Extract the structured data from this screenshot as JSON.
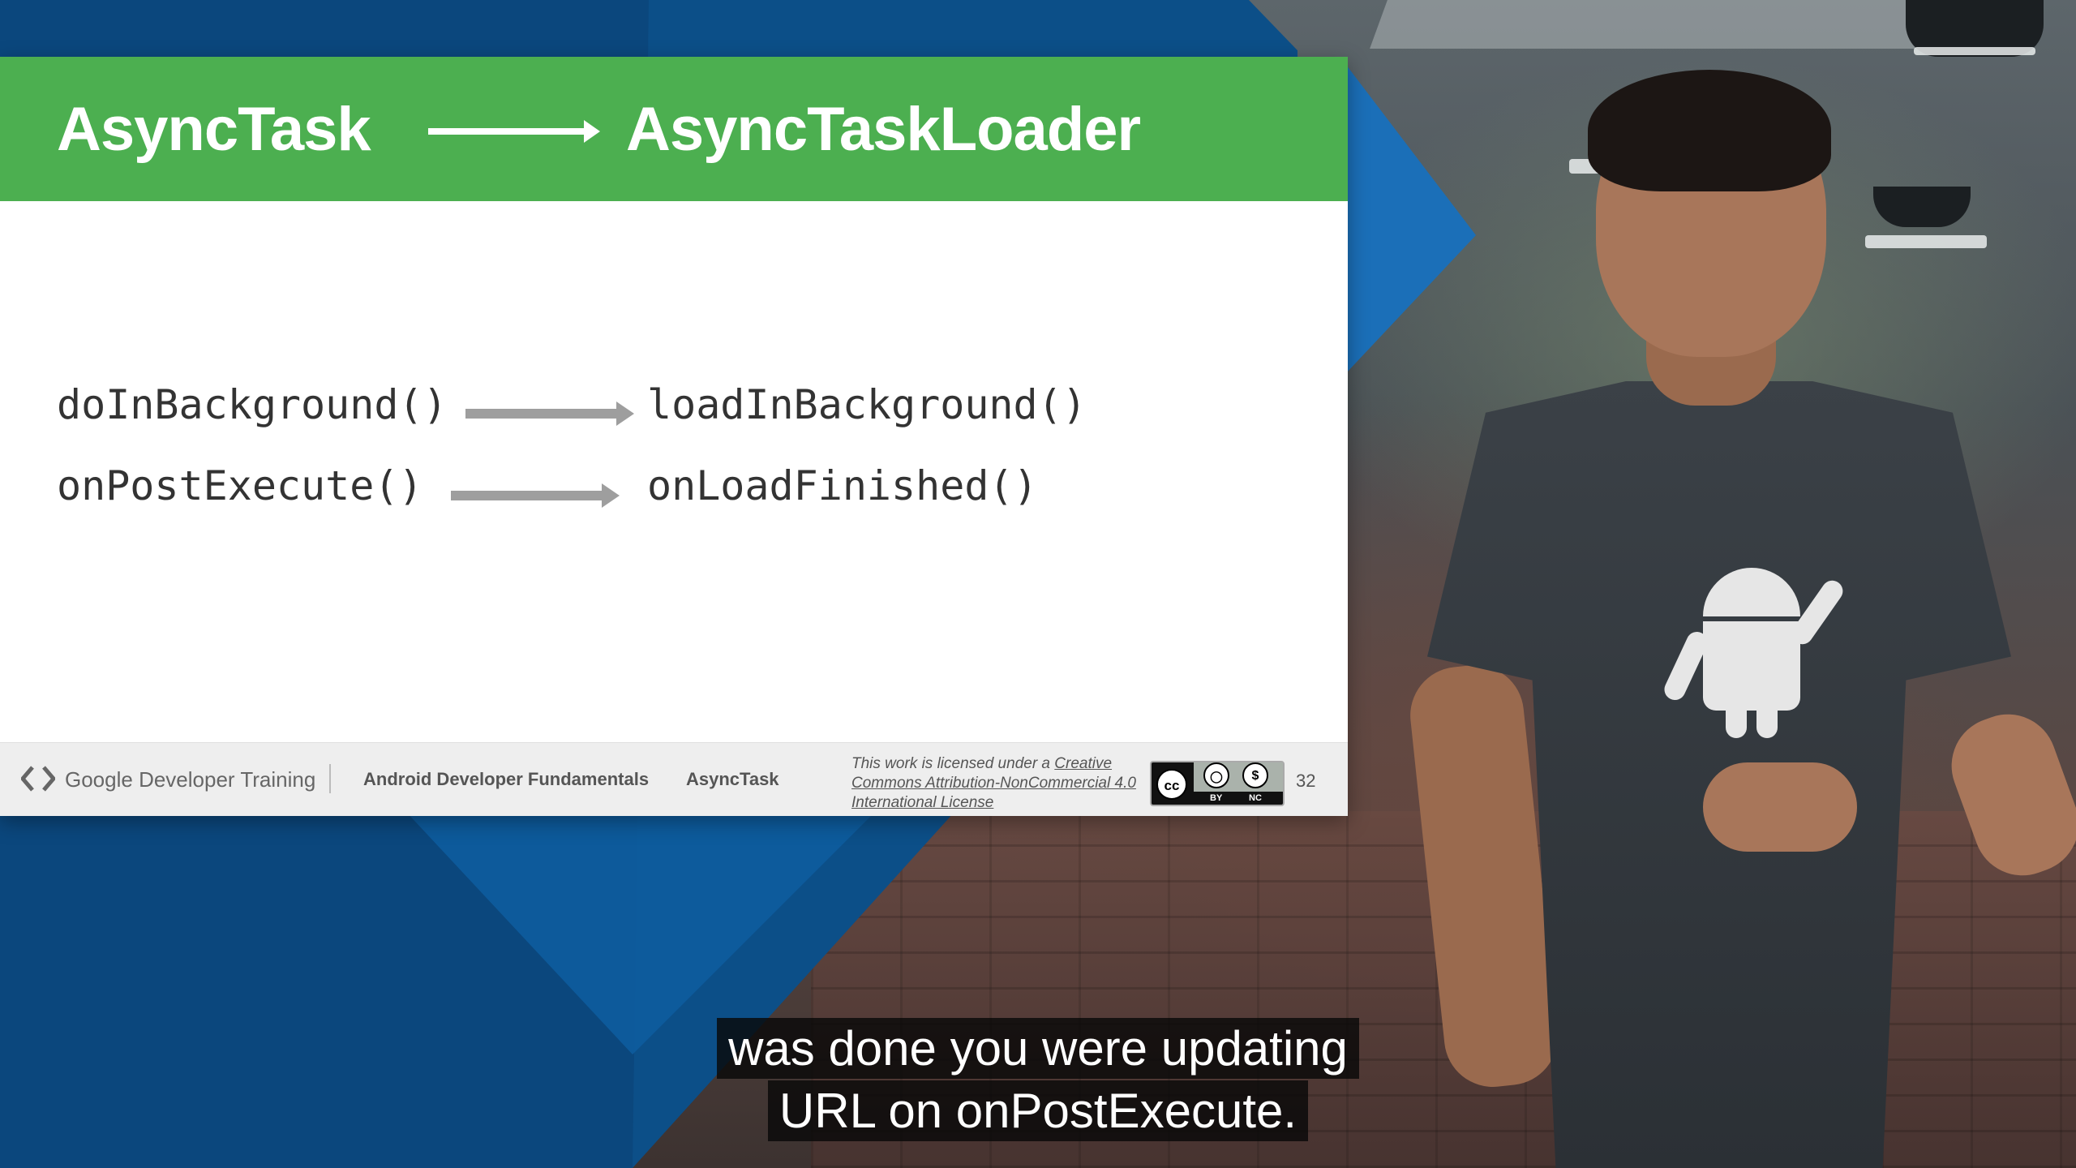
{
  "slide": {
    "header": {
      "left_title": "AsyncTask",
      "right_title": "AsyncTaskLoader"
    },
    "mappings": [
      {
        "from": "doInBackground()",
        "to": "loadInBackground()"
      },
      {
        "from": "onPostExecute()",
        "to": "onLoadFinished()"
      }
    ],
    "footer": {
      "brand": "Google Developer Training",
      "course": "Android Developer Fundamentals",
      "topic": "AsyncTask",
      "license_prefix": "This work is licensed under a ",
      "license_link": "Creative Commons Attribution-NonCommercial 4.0 International License",
      "cc_by": "BY",
      "cc_nc": "NC",
      "cc_mark": "cc",
      "page_number": "32"
    },
    "colors": {
      "header_bg": "#4caf50",
      "arrow": "#9e9e9e",
      "backdrop_blue": "#0c4f88"
    }
  },
  "subtitle": {
    "line1": "was done you were updating",
    "line2": "URL on onPostExecute."
  },
  "icons": {
    "gdt_logo": "chevrons-logo-icon",
    "cc_license": "creative-commons-icon",
    "android_robot": "android-robot-icon"
  }
}
